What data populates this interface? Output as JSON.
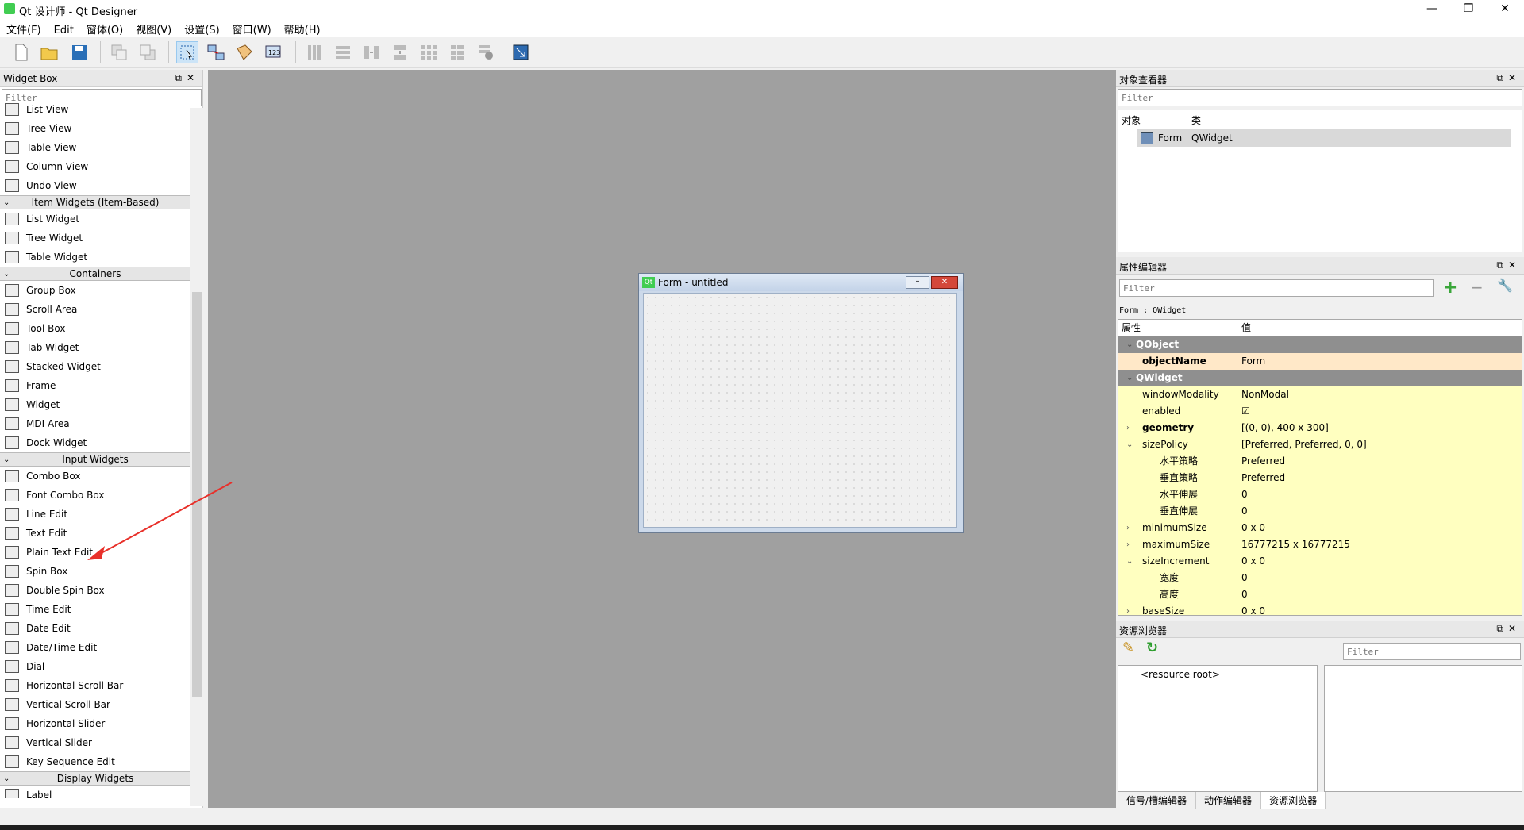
{
  "window": {
    "title": "Qt 设计师 - Qt Designer",
    "minimize": "—",
    "restore": "❐",
    "close": "✕"
  },
  "menu": [
    "文件(F)",
    "Edit",
    "窗体(O)",
    "视图(V)",
    "设置(S)",
    "窗口(W)",
    "帮助(H)"
  ],
  "widget_box": {
    "title": "Widget Box",
    "filter_placeholder": "Filter",
    "items": [
      {
        "kind": "item",
        "label": "List View"
      },
      {
        "kind": "item",
        "label": "Tree View"
      },
      {
        "kind": "item",
        "label": "Table View"
      },
      {
        "kind": "item",
        "label": "Column View"
      },
      {
        "kind": "item",
        "label": "Undo View"
      },
      {
        "kind": "cat",
        "label": "Item Widgets (Item-Based)"
      },
      {
        "kind": "item",
        "label": "List Widget"
      },
      {
        "kind": "item",
        "label": "Tree Widget"
      },
      {
        "kind": "item",
        "label": "Table Widget"
      },
      {
        "kind": "cat",
        "label": "Containers"
      },
      {
        "kind": "item",
        "label": "Group Box"
      },
      {
        "kind": "item",
        "label": "Scroll Area"
      },
      {
        "kind": "item",
        "label": "Tool Box"
      },
      {
        "kind": "item",
        "label": "Tab Widget"
      },
      {
        "kind": "item",
        "label": "Stacked Widget"
      },
      {
        "kind": "item",
        "label": "Frame"
      },
      {
        "kind": "item",
        "label": "Widget"
      },
      {
        "kind": "item",
        "label": "MDI Area"
      },
      {
        "kind": "item",
        "label": "Dock Widget"
      },
      {
        "kind": "cat",
        "label": "Input Widgets"
      },
      {
        "kind": "item",
        "label": "Combo Box"
      },
      {
        "kind": "item",
        "label": "Font Combo Box"
      },
      {
        "kind": "item",
        "label": "Line Edit"
      },
      {
        "kind": "item",
        "label": "Text Edit"
      },
      {
        "kind": "item",
        "label": "Plain Text Edit"
      },
      {
        "kind": "item",
        "label": "Spin Box"
      },
      {
        "kind": "item",
        "label": "Double Spin Box"
      },
      {
        "kind": "item",
        "label": "Time Edit"
      },
      {
        "kind": "item",
        "label": "Date Edit"
      },
      {
        "kind": "item",
        "label": "Date/Time Edit"
      },
      {
        "kind": "item",
        "label": "Dial"
      },
      {
        "kind": "item",
        "label": "Horizontal Scroll Bar"
      },
      {
        "kind": "item",
        "label": "Vertical Scroll Bar"
      },
      {
        "kind": "item",
        "label": "Horizontal Slider"
      },
      {
        "kind": "item",
        "label": "Vertical Slider"
      },
      {
        "kind": "item",
        "label": "Key Sequence Edit"
      },
      {
        "kind": "cat",
        "label": "Display Widgets"
      },
      {
        "kind": "item",
        "label": "Label"
      }
    ]
  },
  "form_window": {
    "title": "Form - untitled",
    "icon_text": "Qt"
  },
  "object_inspector": {
    "title": "对象查看器",
    "filter_placeholder": "Filter",
    "col_object": "对象",
    "col_class": "类",
    "row_object": "Form",
    "row_class": "QWidget"
  },
  "property_editor": {
    "title": "属性编辑器",
    "filter_placeholder": "Filter",
    "context": "Form : QWidget",
    "col_property": "属性",
    "col_value": "值",
    "rows": [
      {
        "type": "group",
        "name": "QObject",
        "value": ""
      },
      {
        "type": "obj",
        "name": "objectName",
        "value": "Form",
        "bold": true
      },
      {
        "type": "group",
        "name": "QWidget",
        "value": ""
      },
      {
        "type": "prop",
        "name": "windowModality",
        "value": "NonModal"
      },
      {
        "type": "prop",
        "name": "enabled",
        "value": "☑"
      },
      {
        "type": "prop",
        "name": "geometry",
        "value": "[(0, 0), 400 x 300]",
        "bold": true,
        "arrow": "›"
      },
      {
        "type": "prop",
        "name": "sizePolicy",
        "value": "[Preferred, Preferred, 0, 0]",
        "arrow": "⌄"
      },
      {
        "type": "sub",
        "name": "水平策略",
        "value": "Preferred"
      },
      {
        "type": "sub",
        "name": "垂直策略",
        "value": "Preferred"
      },
      {
        "type": "sub",
        "name": "水平伸展",
        "value": "0"
      },
      {
        "type": "sub",
        "name": "垂直伸展",
        "value": "0"
      },
      {
        "type": "prop",
        "name": "minimumSize",
        "value": "0 x 0",
        "arrow": "›"
      },
      {
        "type": "prop",
        "name": "maximumSize",
        "value": "16777215 x 16777215",
        "arrow": "›"
      },
      {
        "type": "prop",
        "name": "sizeIncrement",
        "value": "0 x 0",
        "arrow": "⌄"
      },
      {
        "type": "sub",
        "name": "宽度",
        "value": "0"
      },
      {
        "type": "sub",
        "name": "高度",
        "value": "0"
      },
      {
        "type": "prop",
        "name": "baseSize",
        "value": "0 x 0",
        "arrow": "›"
      }
    ]
  },
  "resource_browser": {
    "title": "资源浏览器",
    "filter_placeholder": "Filter",
    "root": "<resource root>",
    "tabs": [
      "信号/槽编辑器",
      "动作编辑器",
      "资源浏览器"
    ]
  }
}
